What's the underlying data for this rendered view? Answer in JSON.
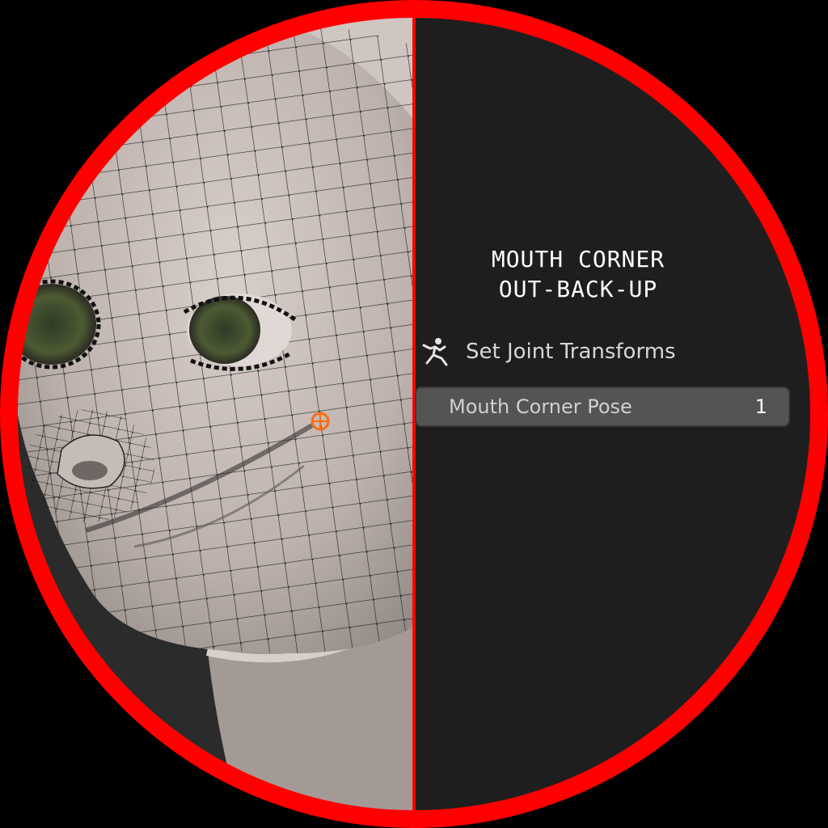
{
  "panel": {
    "title_line1": "MOUTH CORNER",
    "title_line2": "OUT-BACK-UP",
    "operator": {
      "icon": "running-figure-icon",
      "label": "Set Joint Transforms"
    },
    "field": {
      "label": "Mouth Corner Pose",
      "value": "1"
    }
  },
  "colors": {
    "ring": "#ff0000",
    "panel_bg": "#1e1e1e",
    "field_bg": "#545454",
    "joint_marker": "#ff6a13"
  }
}
